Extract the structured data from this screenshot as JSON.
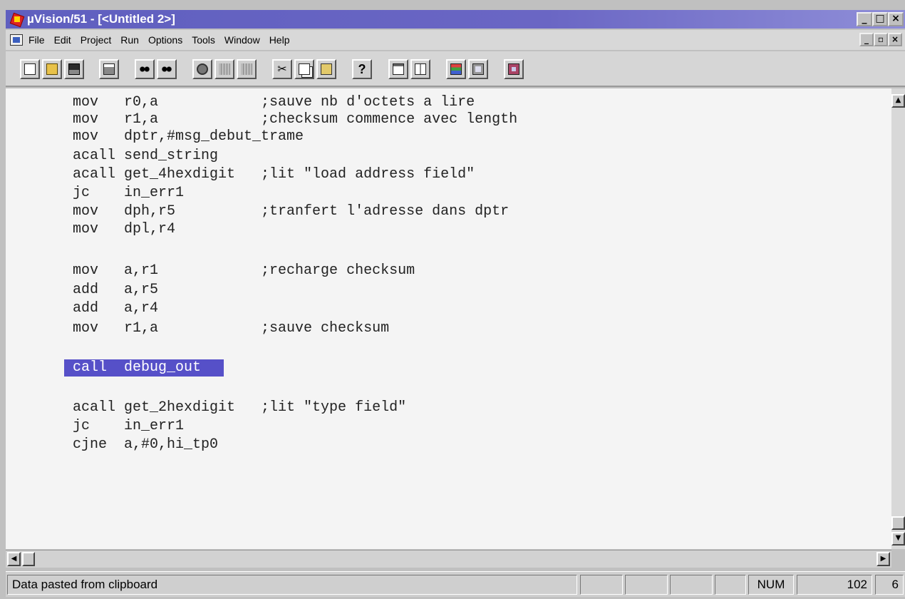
{
  "window": {
    "title": "µVision/51 - [<Untitled 2>]",
    "minimize_glyph": "_",
    "maximize_glyph": "□",
    "close_glyph": "×",
    "restore_glyph": "▫"
  },
  "menu": {
    "items": [
      "File",
      "Edit",
      "Project",
      "Run",
      "Options",
      "Tools",
      "Window",
      "Help"
    ]
  },
  "toolbar": {
    "buttons": [
      "new-file-icon",
      "open-file-icon",
      "save-file-icon",
      "print-icon",
      "find-icon",
      "find-next-icon",
      "build-icon",
      "translate-icon",
      "make-icon",
      "cut-icon",
      "copy-icon",
      "paste-icon",
      "help-icon",
      "window-icon",
      "columns-icon",
      "registers-icon",
      "memory-icon",
      "debugger-icon"
    ]
  },
  "editor": {
    "lines": [
      "mov   r0,a            ;sauve nb d'octets a lire",
      "mov   r1,a            ;checksum commence avec length",
      "mov   dptr,#msg_debut_trame",
      "acall send_string",
      "acall get_4hexdigit   ;lit \"load address field\"",
      "jc    in_err1",
      "mov   dph,r5          ;tranfert l'adresse dans dptr",
      "mov   dpl,r4",
      "",
      "mov   a,r1            ;recharge checksum",
      "add   a,r5",
      "add   a,r4",
      "mov   r1,a            ;sauve checksum",
      "",
      "call  debug_out",
      "",
      "acall get_2hexdigit   ;lit \"type field\"",
      "jc    in_err1",
      "cjne  a,#0,hi_tp0"
    ],
    "selected_line_index": 14,
    "selection_color": "#5650c8"
  },
  "status": {
    "message": "Data pasted from clipboard",
    "num": "NUM",
    "line": "102",
    "col": "6"
  }
}
